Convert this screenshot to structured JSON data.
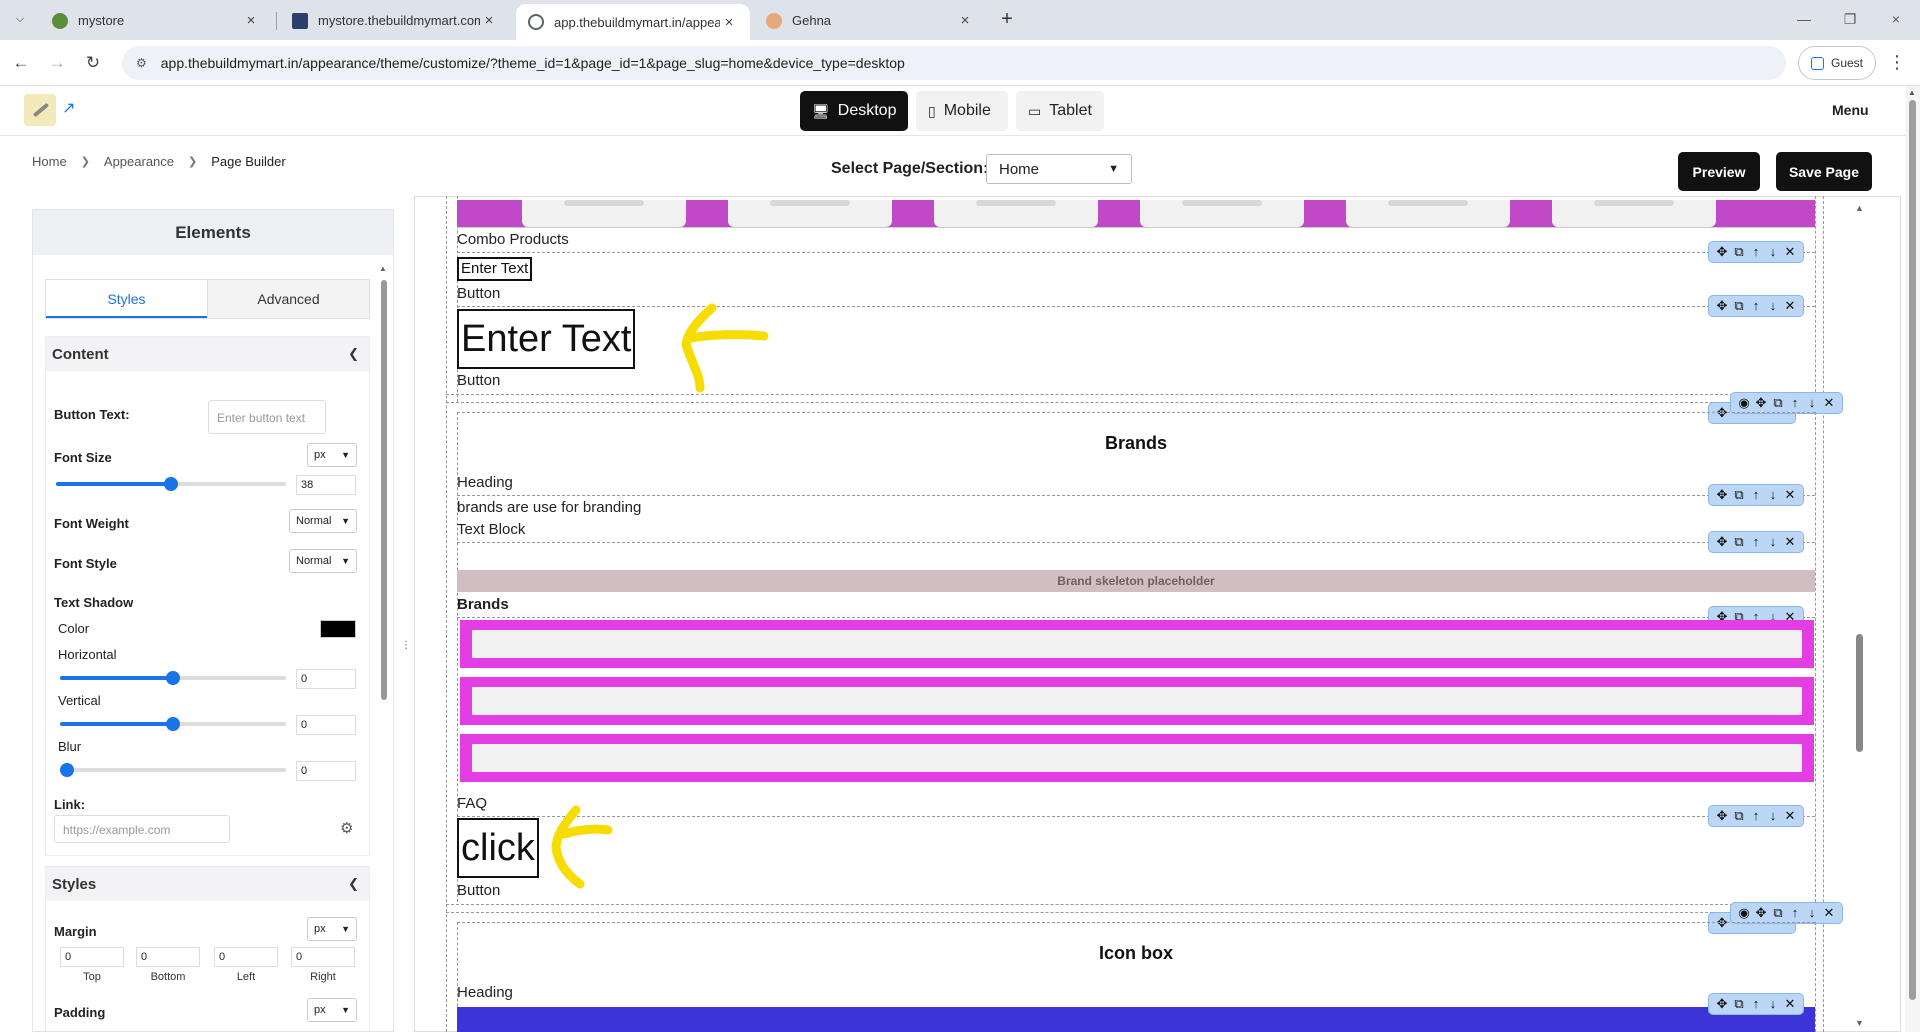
{
  "browser": {
    "tabs": [
      {
        "title": "mystore",
        "favicon_color": "#5b8e3a"
      },
      {
        "title": "mystore.thebuildmymart.com",
        "favicon_color": "#2d3e6e"
      },
      {
        "title": "app.thebuildmymart.in/appeara",
        "favicon_color": "#5f6368",
        "active": true
      },
      {
        "title": "Gehna",
        "favicon_color": "#e8a87c"
      }
    ],
    "url": "app.thebuildmymart.in/appearance/theme/customize/?theme_id=1&page_id=1&page_slug=home&device_type=desktop",
    "profile_label": "Guest"
  },
  "app": {
    "devices": [
      {
        "label": "Desktop",
        "icon": "desktop-icon"
      },
      {
        "label": "Mobile",
        "icon": "mobile-icon"
      },
      {
        "label": "Tablet",
        "icon": "tablet-icon"
      }
    ],
    "menu_label": "Menu",
    "breadcrumb": [
      "Home",
      "Appearance",
      "Page Builder"
    ],
    "select_page_label": "Select Page/Section:",
    "select_page_value": "Home",
    "preview_label": "Preview",
    "save_label": "Save Page"
  },
  "panel": {
    "title": "Elements",
    "tabs": [
      "Styles",
      "Advanced"
    ],
    "content": {
      "title": "Content",
      "button_text_label": "Button Text:",
      "button_text_placeholder": "Enter button text",
      "font_size_label": "Font Size",
      "font_size_unit": "px",
      "font_size_value": "38",
      "font_size_fraction": 0.5,
      "font_weight_label": "Font Weight",
      "font_weight_value": "Normal",
      "font_style_label": "Font Style",
      "font_style_value": "Normal",
      "text_shadow_label": "Text Shadow",
      "color_label": "Color",
      "shadow_color": "#000000",
      "horizontal_label": "Horizontal",
      "horizontal_value": "0",
      "horizontal_fraction": 0.5,
      "vertical_label": "Vertical",
      "vertical_value": "0",
      "vertical_fraction": 0.5,
      "blur_label": "Blur",
      "blur_value": "0",
      "blur_fraction": 0.0,
      "link_label": "Link:",
      "link_placeholder": "https://example.com"
    },
    "styles": {
      "title": "Styles",
      "margin_label": "Margin",
      "margin_unit": "px",
      "margin_values": [
        "0",
        "0",
        "0",
        "0"
      ],
      "side_labels": [
        "Top",
        "Bottom",
        "Left",
        "Right"
      ],
      "padding_label": "Padding",
      "padding_unit": "px"
    }
  },
  "canvas": {
    "combo_products_label": "Combo Products",
    "enter_text_small": "Enter Text",
    "button_label_1": "Button",
    "enter_text_large": "Enter Text",
    "button_label_2": "Button",
    "brands_title": "Brands",
    "heading_label_1": "Heading",
    "brands_description": "brands are use for branding",
    "text_block_label": "Text Block",
    "brand_placeholder": "Brand skeleton placeholder",
    "brands_bold_label": "Brands",
    "faq_label": "FAQ",
    "click_label": "click",
    "button_label_3": "Button",
    "icon_box_title": "Icon box",
    "heading_label_2": "Heading",
    "accent_magenta": "#e23ee3",
    "accent_purple": "#3c34d6",
    "annotation_yellow": "#f7dc00"
  }
}
